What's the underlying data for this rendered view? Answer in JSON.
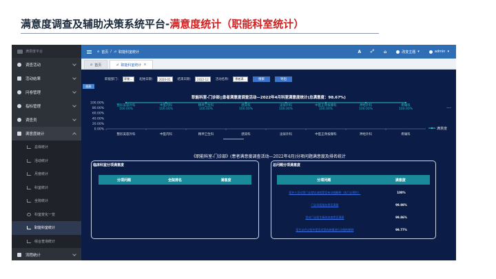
{
  "slide": {
    "title_prefix": "满意度调查及辅助决策系统平台-",
    "title_highlight": "满意度统计（职能科室统计）"
  },
  "app": {
    "logo_text": "满意度平台",
    "sidebar": {
      "items": [
        {
          "label": "调查活动"
        },
        {
          "label": "活动结果"
        },
        {
          "label": "问卷管理"
        },
        {
          "label": "指标管理"
        },
        {
          "label": "调查员"
        },
        {
          "label": "满意度统计"
        }
      ],
      "sub_items": [
        {
          "label": "总体统计"
        },
        {
          "label": "活动统计"
        },
        {
          "label": "月度统计"
        },
        {
          "label": "科室统计"
        },
        {
          "label": "全院统计"
        },
        {
          "label": "科室变化一览"
        },
        {
          "label": "职能科室统计"
        },
        {
          "label": "综合查询统计"
        }
      ],
      "bottom_item": {
        "label": "流程统计"
      }
    },
    "topbar": {
      "breadcrumb_home": "首页",
      "breadcrumb_sep": "/",
      "breadcrumb_current": "职能科室统计",
      "icon_a": "A",
      "theme_label": "改变主题",
      "user_label": "admin"
    },
    "tabs": [
      {
        "label": "首页"
      },
      {
        "label": "职能科室统计"
      }
    ],
    "filter": {
      "dept_label": "职能部门：",
      "dept_value": "职能...",
      "start_label": "起始日期：",
      "start_value": "2020-01",
      "end_label": "结束日期：",
      "end_value": "2022-12",
      "activity_label": "活动名称：",
      "activity_value": "患者满...",
      "search_btn": "搜索",
      "export_btn": "导出",
      "side_tag": "图表"
    },
    "chart_data": {
      "type": "line",
      "title": "职能科室-门诊部||患者满意度调查活动—2022年4月科室满意度统计(总满意度：98.67%)",
      "categories": [
        "整形美容外科",
        "中医内科",
        "精神卫生科",
        "感染科",
        "泌尿外科",
        "中医正骨按摩科",
        "神经外科",
        "疼痛科"
      ],
      "series": [
        {
          "name": "满意度",
          "values": [
            100.0,
            100.0,
            100.0,
            100.0,
            100.0,
            100.0,
            100.0,
            100.0
          ]
        }
      ],
      "data_labels": [
        "100.00%",
        "100.00%",
        "100.00%",
        "100.00%",
        "100.00%",
        "100.00%",
        "100.00%",
        "100.00%"
      ],
      "y_ticks": [
        "100.00%",
        "80.00%",
        "60.00%",
        "40.00%",
        "20.00%",
        "0.00%"
      ],
      "ylim": [
        0,
        100
      ],
      "legend": "right",
      "more": "…"
    },
    "section_title": "《职能科室-门诊部》(患者满意度调查活动—2022年4月)分项问题满意度及排名统计",
    "left_panel": {
      "title": "临床科室分项满意度",
      "headers": [
        "分项问题",
        "全院排名",
        "满意度"
      ]
    },
    "right_panel": {
      "title": "总问题分项满意度",
      "headers": [
        "分项问题",
        "满意度"
      ],
      "rows": [
        {
          "question": "医护人员对您门诊就诊流程是否有详细解释（如门诊预约）",
          "value": "100%"
        },
        {
          "question": "门诊导医服务是否满意",
          "value": "99.98%"
        },
        {
          "question": "您对门诊医生服务态度是否满意",
          "value": "99.86%"
        },
        {
          "question": "医生诊疗过程中是否对您的病情进行详细的解释",
          "value": "99.77%"
        }
      ]
    }
  }
}
